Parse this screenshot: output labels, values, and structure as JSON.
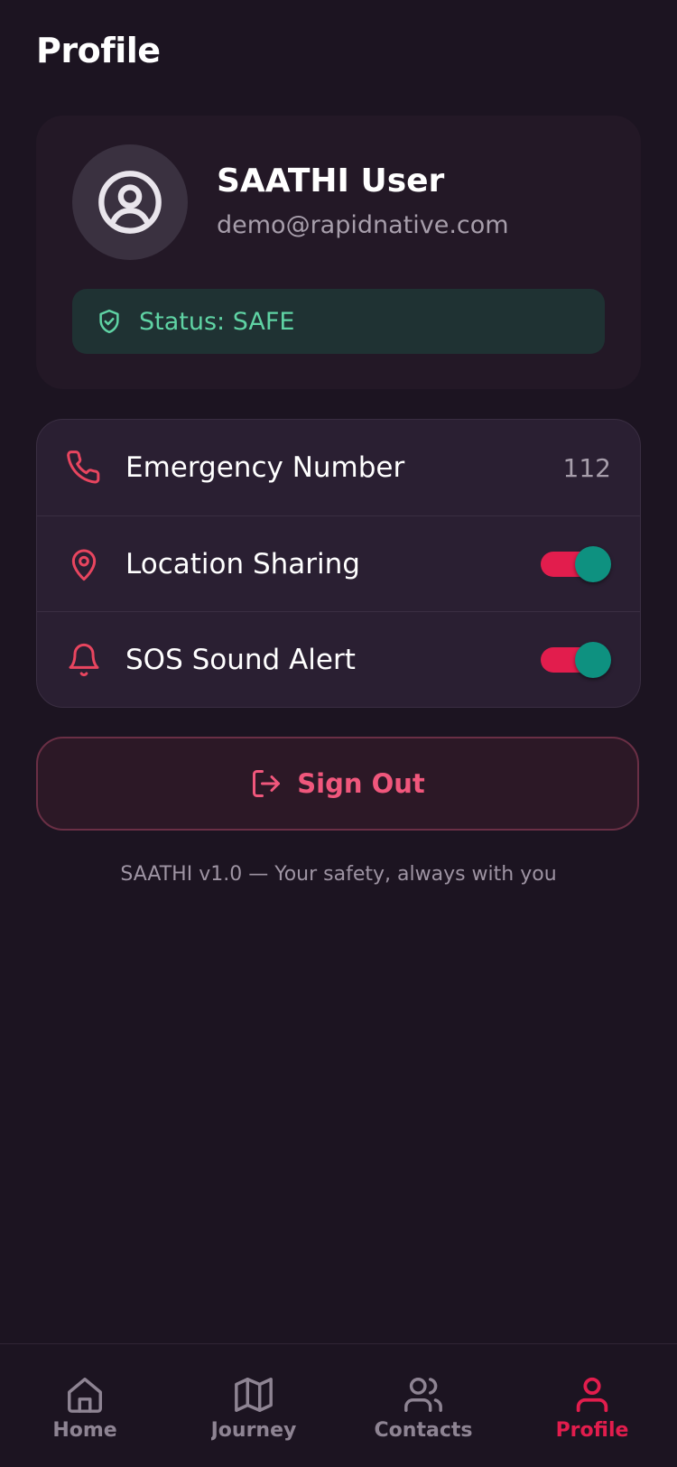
{
  "header": {
    "title": "Profile"
  },
  "profile": {
    "name": "SAATHI User",
    "email": "demo@rapidnative.com",
    "avatar_icon": "user-circle-icon",
    "status_text": "Status: SAFE",
    "status_icon": "shield-check-icon",
    "status_color": "#5fd3a4"
  },
  "settings": {
    "emergency_number_label": "Emergency Number",
    "emergency_number_value": "112",
    "location_sharing_label": "Location Sharing",
    "location_sharing_on": true,
    "sos_sound_label": "SOS Sound Alert",
    "sos_sound_on": true
  },
  "actions": {
    "sign_out_label": "Sign Out",
    "sign_out_icon": "log-out-icon"
  },
  "footer": {
    "note": "SAATHI v1.0 — Your safety, always with you"
  },
  "tabs": [
    {
      "label": "Home",
      "icon": "home-icon",
      "active": false
    },
    {
      "label": "Journey",
      "icon": "map-icon",
      "active": false
    },
    {
      "label": "Contacts",
      "icon": "users-icon",
      "active": false
    },
    {
      "label": "Profile",
      "icon": "user-icon",
      "active": true
    }
  ],
  "colors": {
    "accent": "#e21d4d",
    "toggle_knob": "#0e9180",
    "background": "#1c1421"
  }
}
